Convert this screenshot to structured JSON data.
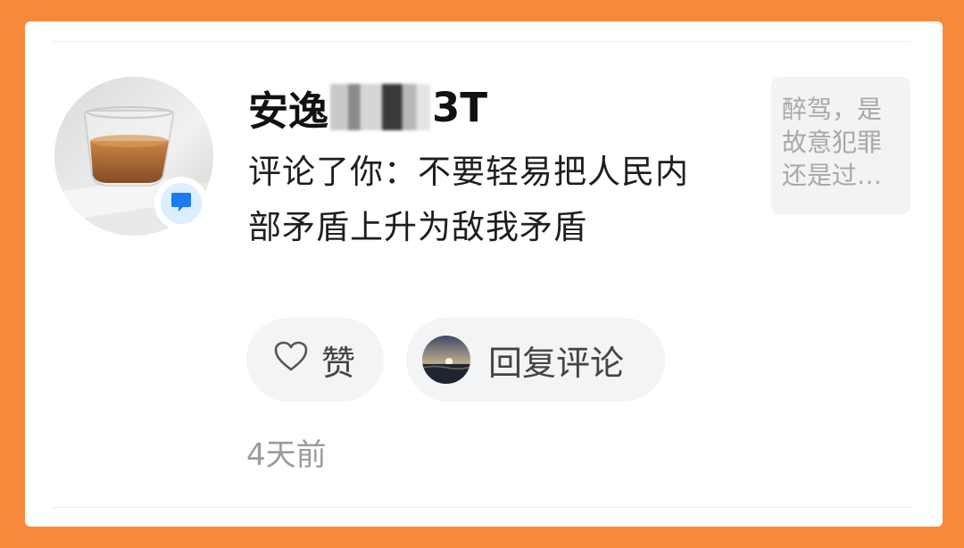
{
  "notification": {
    "username_prefix": "安逸",
    "username_suffix": "3T",
    "comment_text": "评论了你：不要轻易把人民内部矛盾上升为敌我矛盾",
    "quoted_preview": "醉驾，是故意犯罪还是过…",
    "timestamp": "4天前"
  },
  "actions": {
    "like_label": "赞",
    "reply_label": "回复评论"
  },
  "icons": {
    "badge": "comment-bubble-icon",
    "like": "heart-outline-icon"
  },
  "colors": {
    "frame_border": "#f7893a",
    "badge_accent": "#1a7cf0",
    "badge_bg": "#dceeff",
    "button_bg": "#f3f4f5",
    "secondary_text": "#9b9b9b"
  }
}
